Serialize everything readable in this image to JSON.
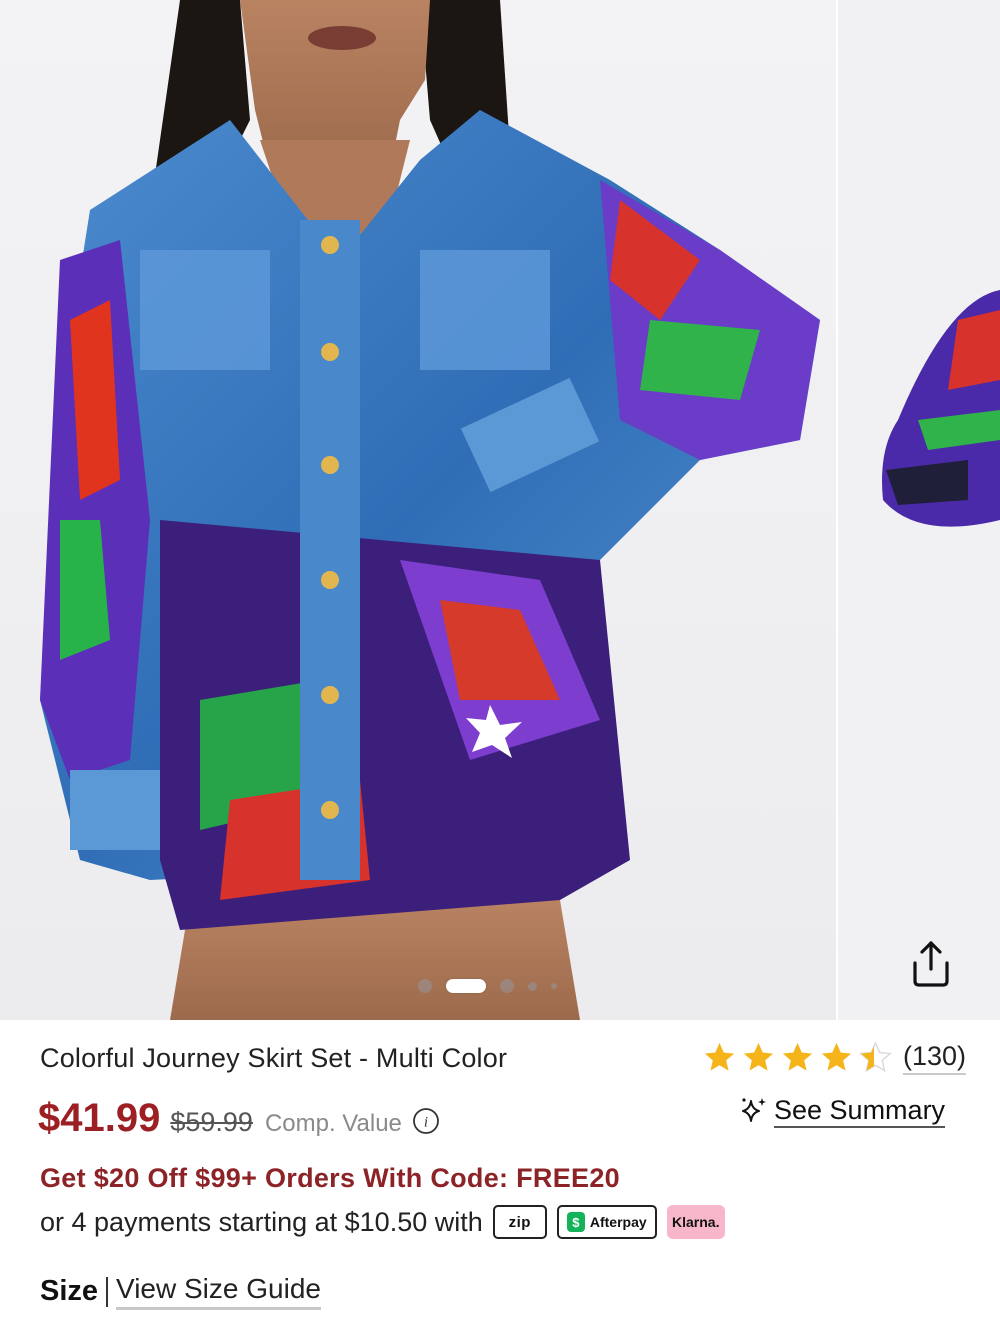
{
  "gallery": {
    "main_image": "product-photo-colorful-journey-skirt-set",
    "peek_image": "product-photo-next",
    "share_icon": "share-icon",
    "slide_count": 5,
    "active_slide": 2
  },
  "product": {
    "title": "Colorful Journey Skirt Set - Multi Color",
    "rating_value": 4.5,
    "review_count": "(130)",
    "price": "$41.99",
    "old_price": "$59.99",
    "comp_value_label": "Comp. Value",
    "info_icon": "info-icon",
    "summary_icon": "sparkle-icon",
    "summary_label": "See Summary"
  },
  "promo": {
    "text": "Get $20 Off $99+ Orders With Code: FREE20"
  },
  "payments": {
    "text": "or 4 payments starting at $10.50 with",
    "providers": [
      "zip",
      "Afterpay",
      "Klarna."
    ]
  },
  "size": {
    "label": "Size",
    "guide_link": "View Size Guide"
  },
  "colors": {
    "price_red": "#9c1f24",
    "promo_red": "#8c2327",
    "star_gold": "#f5b51a",
    "afterpay_green": "#14b35a",
    "klarna_pink": "#f7b6c9"
  }
}
